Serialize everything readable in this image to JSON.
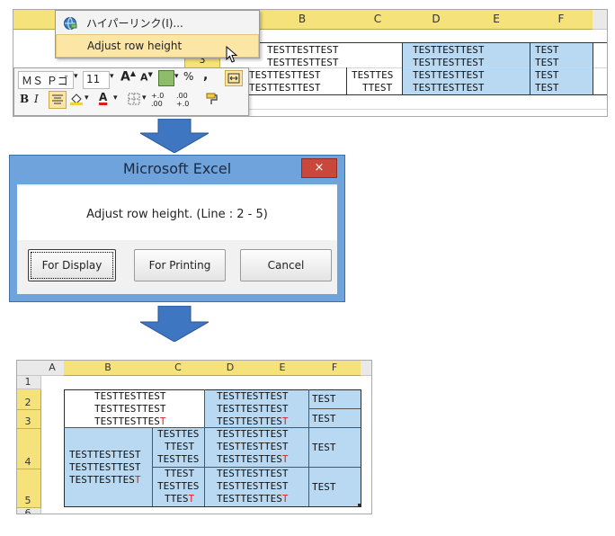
{
  "panel1": {
    "context_menu": {
      "items": [
        {
          "label": "ハイパーリンク(I)...",
          "icon": "hyperlink-globe-icon"
        },
        {
          "label": "Adjust row height",
          "icon": ""
        }
      ]
    },
    "columns": [
      "B",
      "C",
      "D",
      "E",
      "F"
    ],
    "row_label": "3",
    "mini_toolbar": {
      "font_name": "ＭＳ Ｐゴ",
      "font_size": "11",
      "percent": "%",
      "comma": ",",
      "bold": "B",
      "italic": "I",
      "font_color_letter": "A",
      "inc_decimal": "+.0 .00",
      "dec_decimal": ".00 +.0"
    },
    "cells": {
      "b_row1": "TESTTESTTEST",
      "b_row2": "TESTTESTTEST",
      "b_row3": "TESTTESTTEST",
      "b_row4": "TESTTESTTEST",
      "c_row3": "TESTTES",
      "c_row4": "TTEST",
      "d_row1": "TESTTESTTEST",
      "d_row2": "TESTTESTTEST",
      "d_row3": "TESTTESTTEST",
      "d_row4": "TESTTESTTEST",
      "f_row1": "TEST",
      "f_row2": "TEST",
      "f_row3": "TEST",
      "f_row4": "TEST"
    }
  },
  "dialog": {
    "title": "Microsoft Excel",
    "close": "×",
    "message": "Adjust row height. (Line : 2 - 5)",
    "buttons": {
      "display": "For Display",
      "printing": "For Printing",
      "cancel": "Cancel"
    }
  },
  "panel3": {
    "corner": "",
    "columns": [
      "A",
      "B",
      "C",
      "D",
      "E",
      "F"
    ],
    "rows": [
      "1",
      "2",
      "3",
      "4",
      "5",
      "6"
    ],
    "block1": {
      "b": [
        "TESTTESTTEST",
        "TESTTESTTEST",
        "TESTTESTTES",
        "T"
      ],
      "d": [
        "TESTTESTTEST",
        "TESTTESTTEST",
        "TESTTESTTES",
        "T"
      ],
      "f": [
        "TEST",
        "TEST"
      ]
    },
    "block2": {
      "b": [
        "TESTTESTTEST",
        "TESTTESTTEST",
        "TESTTESTTES",
        "T"
      ],
      "c": [
        "TESTTES",
        "TTEST",
        "TESTTES",
        "TTEST",
        "TESTTES",
        "TTES",
        "T"
      ],
      "d": [
        "TESTTESTTEST",
        "TESTTESTTEST",
        "TESTTESTTES",
        "T",
        "TESTTESTTEST",
        "TESTTESTTEST",
        "TESTTESTTES",
        "T"
      ],
      "f": [
        "TEST",
        "TEST"
      ]
    }
  },
  "colors": {
    "header_highlight": "#f6e27a",
    "cell_blue": "#b9d9f3",
    "arrow_blue": "#3f76c2",
    "dialog_frame": "#6fa3dc",
    "close_red": "#c9473b",
    "red_text": "#e02020"
  }
}
